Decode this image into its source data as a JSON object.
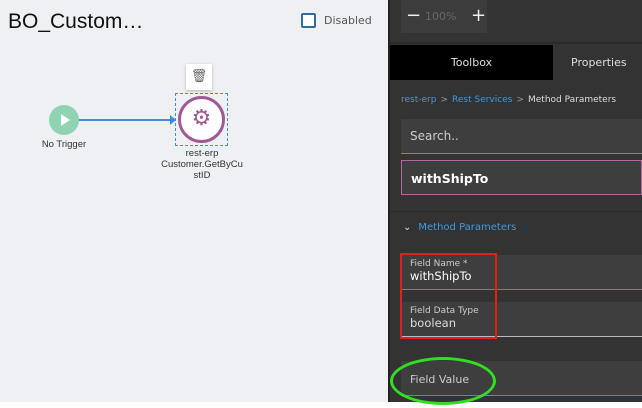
{
  "canvas": {
    "title": "BO_Custom…",
    "disabled_label": "Disabled",
    "disabled_checked": false,
    "trigger_label": "No Trigger",
    "node": {
      "name": "rest-erp",
      "method_line1": "Customer.GetByCu",
      "method_line2": "stID"
    }
  },
  "zoom": {
    "minus": "−",
    "value": "100%",
    "plus": "+"
  },
  "tabs": [
    {
      "label": "Toolbox"
    },
    {
      "label": "Properties"
    }
  ],
  "breadcrumb": {
    "items": [
      "rest-erp",
      "Rest Services",
      "Method Parameters"
    ],
    "sep": ">"
  },
  "search": {
    "placeholder": "Search.."
  },
  "selected_param": "withShipTo",
  "section": {
    "title": "Method Parameters"
  },
  "fields": {
    "name_label": "Field Name *",
    "name_value": "withShipTo",
    "type_label": "Field Data Type",
    "type_value": "boolean",
    "value_label": "Field Value"
  },
  "annotations": {
    "red": "#e02020",
    "green": "#33dd22"
  }
}
